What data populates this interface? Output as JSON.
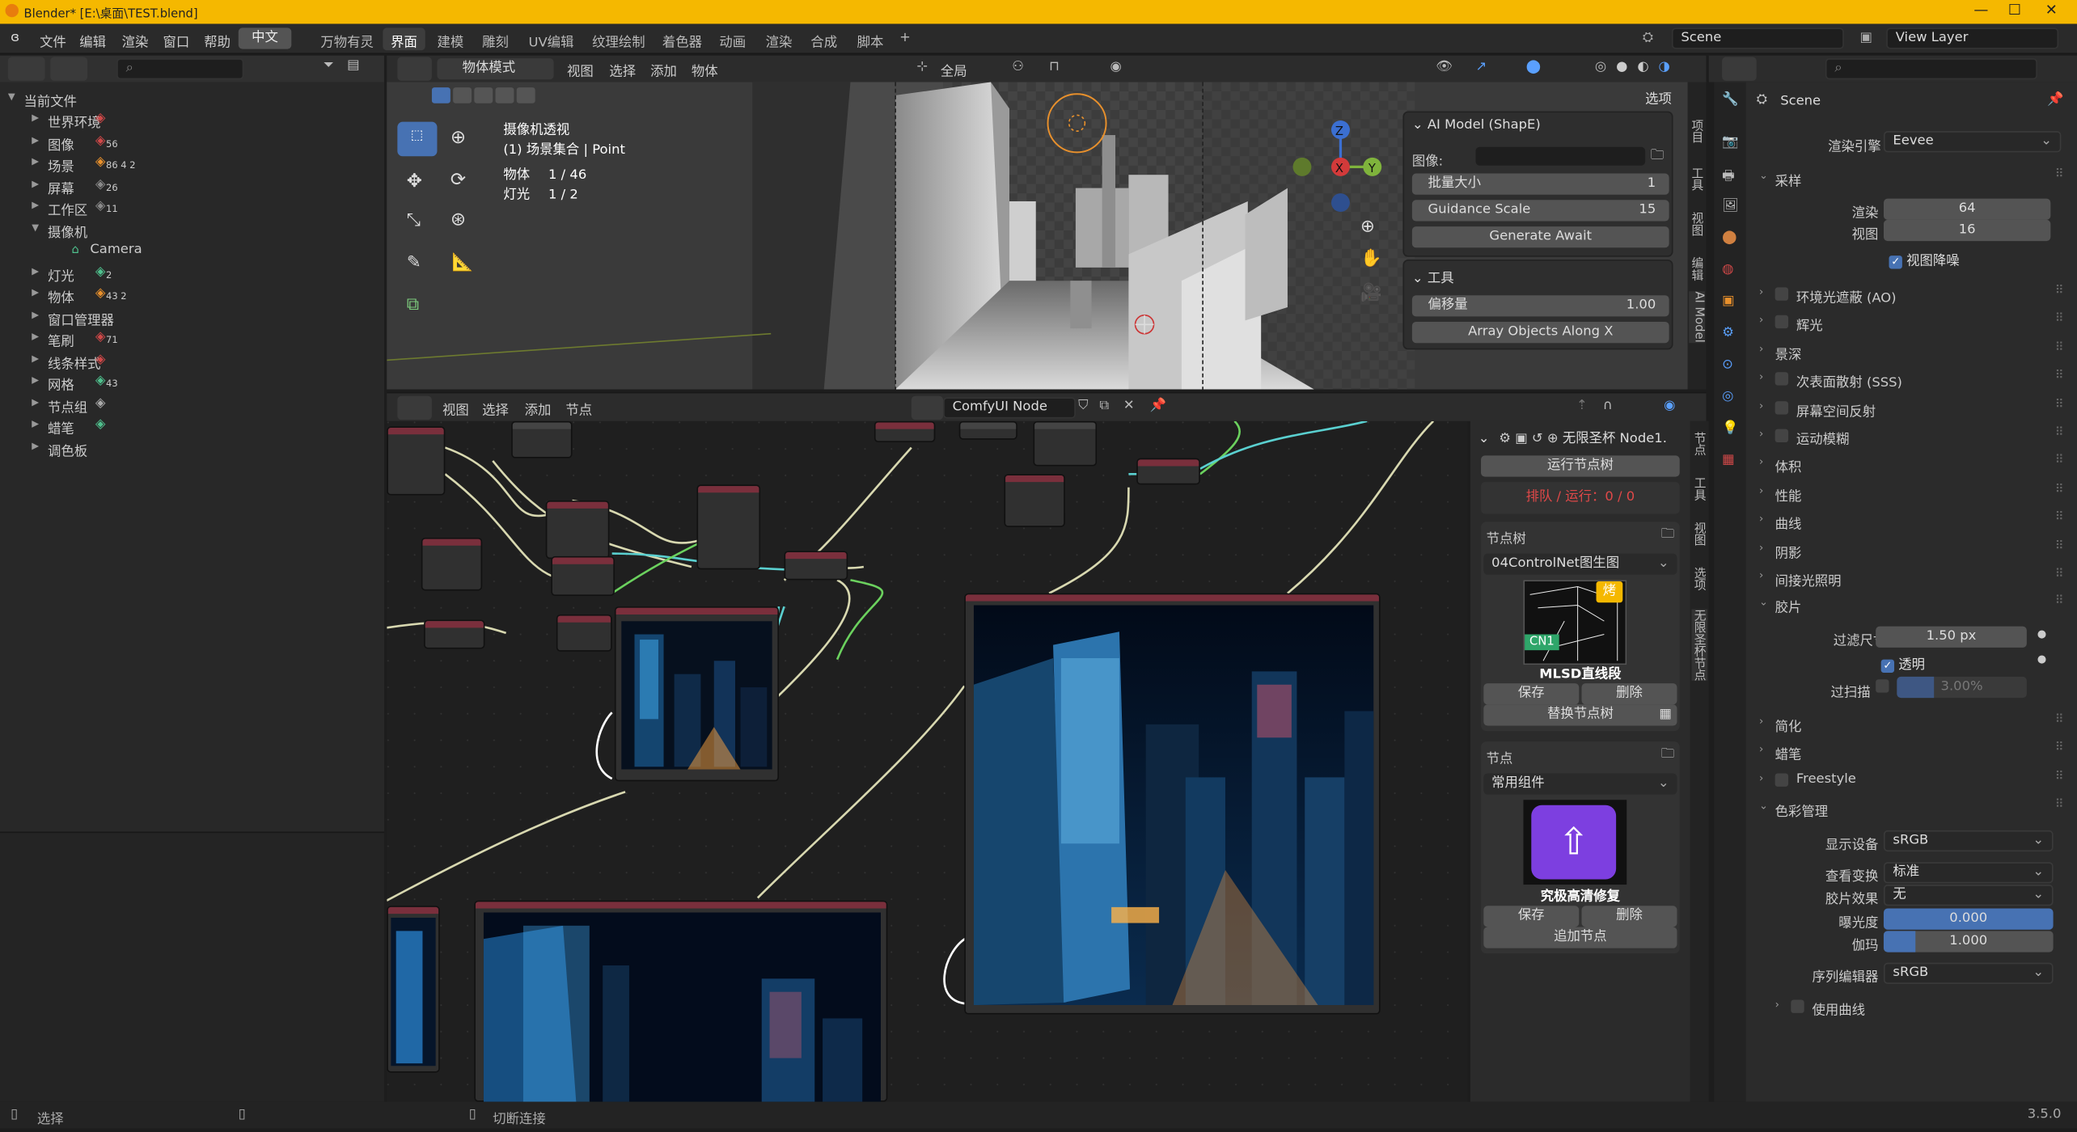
{
  "window": {
    "title": "Blender* [E:\\桌面\\TEST.blend]",
    "min": "—",
    "max": "☐",
    "close": "✕"
  },
  "menu": {
    "items": [
      "文件",
      "编辑",
      "渲染",
      "窗口",
      "帮助"
    ],
    "lang": "中文",
    "workspaces": [
      "万物有灵",
      "界面",
      "建模",
      "雕刻",
      "UV编辑",
      "纹理绘制",
      "着色器",
      "动画",
      "渲染",
      "合成",
      "脚本",
      "+"
    ],
    "active_workspace": "界面",
    "scene": "Scene",
    "view_layer": "View Layer"
  },
  "outliner": {
    "root": "当前文件",
    "items": [
      {
        "label": "世界环境",
        "expanded": false,
        "count": ""
      },
      {
        "label": "图像",
        "expanded": false,
        "count": "56"
      },
      {
        "label": "场景",
        "expanded": false,
        "count": "86  4  2"
      },
      {
        "label": "屏幕",
        "expanded": false,
        "count": "26"
      },
      {
        "label": "工作区",
        "expanded": false,
        "count": "11"
      },
      {
        "label": "摄像机",
        "expanded": true,
        "count": ""
      },
      {
        "label": "Camera",
        "child": true,
        "count": ""
      },
      {
        "label": "灯光",
        "expanded": false,
        "count": "2"
      },
      {
        "label": "物体",
        "expanded": false,
        "count": "43  2"
      },
      {
        "label": "窗口管理器",
        "expanded": false,
        "count": ""
      },
      {
        "label": "笔刷",
        "expanded": false,
        "count": "71"
      },
      {
        "label": "线条样式",
        "expanded": false,
        "count": ""
      },
      {
        "label": "网格",
        "expanded": false,
        "count": "43"
      },
      {
        "label": "节点组",
        "expanded": false,
        "count": ""
      },
      {
        "label": "蜡笔",
        "expanded": false,
        "count": ""
      },
      {
        "label": "调色板",
        "expanded": false,
        "count": ""
      }
    ]
  },
  "viewport": {
    "mode": "物体模式",
    "menus": [
      "视图",
      "选择",
      "添加",
      "物体"
    ],
    "transform": "全局",
    "options_label": "选项",
    "info": {
      "title": "摄像机透视",
      "collection": "(1) 场景集合 | Point",
      "objects_label": "物体",
      "objects_val": "1 / 46",
      "lights_label": "灯光",
      "lights_val": "1 / 2"
    },
    "ai_panel": {
      "title": "AI Model (ShapE)",
      "image_label": "图像:",
      "batch_label": "批量大小",
      "batch_val": "1",
      "guidance_label": "Guidance Scale",
      "guidance_val": "15",
      "generate": "Generate Await"
    },
    "tool_panel": {
      "title": "工具",
      "offset_label": "偏移量",
      "offset_val": "1.00",
      "array_btn": "Array Objects Along X"
    },
    "side_tabs": [
      "项目",
      "工具",
      "视图",
      "编辑",
      "AI Model"
    ]
  },
  "node_editor": {
    "menus": [
      "视图",
      "选择",
      "添加",
      "节点"
    ],
    "tree_name": "ComfyUI Node",
    "side_tabs": [
      "节点",
      "工具",
      "视图",
      "选项",
      "无限圣杯节点"
    ]
  },
  "npanel": {
    "header": "无限圣杯 Node1.",
    "run": "运行节点树",
    "queue": "排队 / 运行：0 / 0",
    "tree_section": "节点树",
    "tree_select": "04ControlNet图生图",
    "thumb_badge": "CN1",
    "thumb_tag": "烤",
    "thumb_caption": "MLSD直线段",
    "save": "保存",
    "delete": "删除",
    "replace": "替换节点树",
    "node_section": "节点",
    "node_select": "常用组件",
    "node_caption": "究极高清修复",
    "save2": "保存",
    "delete2": "删除",
    "add_node": "追加节点"
  },
  "properties": {
    "scene": "Scene",
    "engine_label": "渲染引擎",
    "engine": "Eevee",
    "sampling": "采样",
    "render_label": "渲染",
    "render_val": "64",
    "viewport_label": "视图",
    "viewport_val": "16",
    "denoise": "视图降噪",
    "sections": [
      "环境光遮蔽 (AO)",
      "辉光",
      "景深",
      "次表面散射 (SSS)",
      "屏幕空间反射",
      "运动模糊",
      "体积",
      "性能",
      "曲线",
      "阴影",
      "间接光照明"
    ],
    "film": "胶片",
    "filter_label": "过滤尺寸",
    "filter_val": "1.50 px",
    "transparent": "透明",
    "overscan_label": "过扫描",
    "overscan_val": "3.00%",
    "simplify": "简化",
    "gpencil": "蜡笔",
    "freestyle": "Freestyle",
    "color_mgmt": "色彩管理",
    "display_label": "显示设备",
    "display_val": "sRGB",
    "view_label": "查看变换",
    "view_val": "标准",
    "look_label": "胶片效果",
    "look_val": "无",
    "exposure_label": "曝光度",
    "exposure_val": "0.000",
    "gamma_label": "伽玛",
    "gamma_val": "1.000",
    "seq_label": "序列编辑器",
    "seq_val": "sRGB",
    "curves": "使用曲线"
  },
  "status": {
    "left": "选择",
    "mid": "切断连接",
    "version": "3.5.0"
  }
}
